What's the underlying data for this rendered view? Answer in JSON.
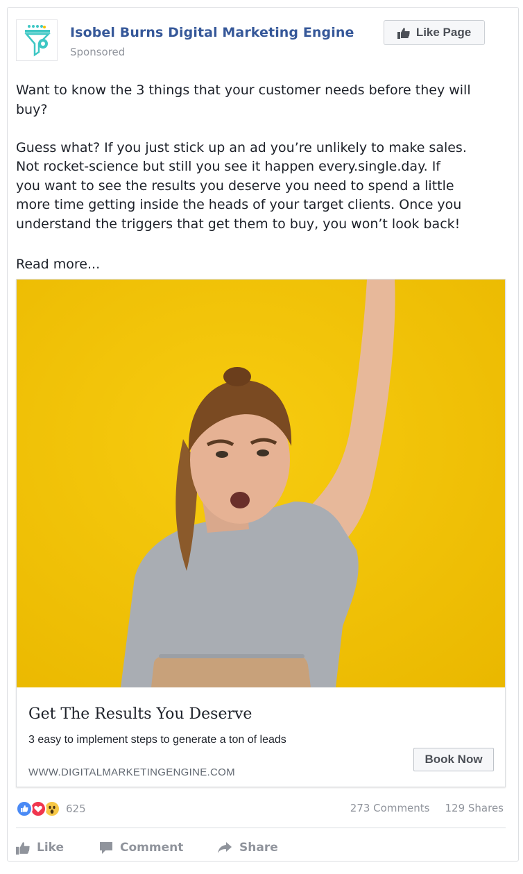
{
  "post": {
    "page_name": "Isobel Burns Digital Marketing Engine",
    "sponsored_label": "Sponsored",
    "like_page_label": "Like Page",
    "paragraphs": [
      "Want to know the 3 things that your customer needs before they will\nbuy?",
      "Guess what? If you just stick up an ad you’re unlikely to make sales.\nNot rocket-science but still you see it happen every.single.day. If\nyou want to see the results you deserve you need to spend a little\nmore time getting inside the heads of your target clients. Once you\nunderstand the triggers that get them to buy, you won’t look back!"
    ],
    "read_more": "Read more..."
  },
  "attachment": {
    "title": "Get The Results You Deserve",
    "description": "3 easy to implement steps to generate a ton of leads",
    "domain": "WWW.DIGITALMARKETINGENGINE.COM",
    "cta_label": "Book Now"
  },
  "engagement": {
    "reaction_count": "625",
    "comments": "273 Comments",
    "shares": "129 Shares"
  },
  "actions": {
    "like": "Like",
    "comment": "Comment",
    "share": "Share"
  },
  "colors": {
    "link_blue": "#365899",
    "logo_teal": "#3ec7c4",
    "photo_yellow": "#f2c200",
    "like_reaction": "#4a8af5",
    "love_reaction": "#f0364e",
    "wow_reaction": "#f7c846"
  },
  "icons": [
    "thumbs-up-icon",
    "comment-icon",
    "share-icon",
    "funnel-gear-logo-icon",
    "like-reaction-icon",
    "love-reaction-icon",
    "wow-reaction-icon"
  ]
}
